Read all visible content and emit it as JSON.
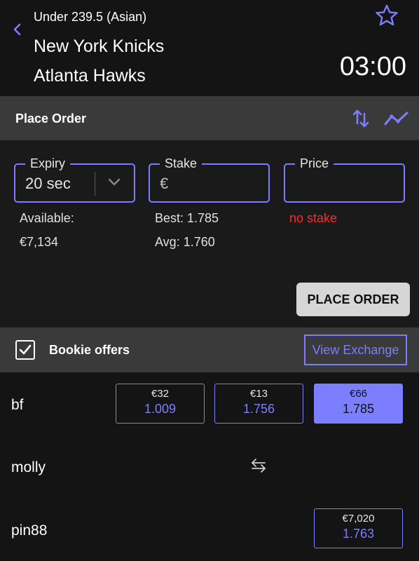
{
  "event": {
    "subtitle": "Under 239.5 (Asian)",
    "home_team": "New York Knicks",
    "away_team": "Atlanta Hawks",
    "clock": "03:00"
  },
  "order": {
    "title": "Place Order",
    "expiry_label": "Expiry",
    "expiry_value": "20 sec",
    "stake_label": "Stake",
    "stake_value": "€",
    "price_label": "Price",
    "price_value": "",
    "available_label": "Available:",
    "available_value": "€7,134",
    "best": "Best: 1.785",
    "avg": "Avg: 1.760",
    "error": "no stake",
    "place_button": "PLACE ORDER"
  },
  "bookies": {
    "title": "Bookie offers",
    "checked": true,
    "view_exchange": "View Exchange",
    "rows": [
      {
        "name": "bf",
        "offers": [
          {
            "stake": "€32",
            "price": "1.009",
            "selected": false
          },
          {
            "stake": "€13",
            "price": "1.756",
            "selected": false
          },
          {
            "stake": "€66",
            "price": "1.785",
            "selected": true
          }
        ]
      },
      {
        "name": "molly",
        "offers": []
      },
      {
        "name": "pin88",
        "offers": [
          {
            "stake": "€7,020",
            "price": "1.763",
            "selected": false
          }
        ]
      }
    ]
  },
  "icons": {
    "back": "chevron-left-icon",
    "favorite": "star-outline-icon",
    "sort": "swap-vertical-icon",
    "chart": "trend-line-icon",
    "expiry_dropdown": "chevron-down-icon",
    "swap": "swap-horizontal-icon"
  },
  "colors": {
    "accent": "#7b7fff",
    "error": "#ff2a2a",
    "bar": "#3a3a3a",
    "background": "#141414"
  }
}
